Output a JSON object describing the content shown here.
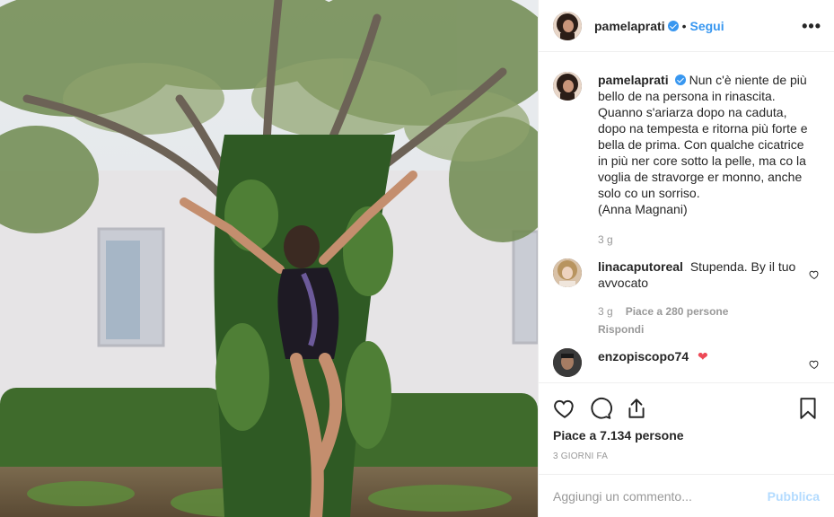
{
  "post": {
    "author": "pamelaprati",
    "follow_label": "Segui",
    "dot": "•",
    "more_label": "•••",
    "caption": {
      "username": "pamelaprati",
      "text_lines": [
        "Nun c'è niente de più",
        "bello de na persona in rinascita.",
        "Quanno s'ariarza dopo na caduta,",
        "dopo na tempesta e ritorna più forte e",
        "bella de prima. Con qualche cicatrice",
        "in più ner core sotto la pelle, ma co la",
        "voglia de stravorge er monno, anche",
        "solo co un sorriso.",
        "(Anna Magnani)"
      ],
      "time": "3 g"
    },
    "comments": [
      {
        "username": "linacaputoreal",
        "text": "Stupenda. By il tuo avvocato",
        "time": "3 g",
        "likes": "Piace a 280 persone",
        "reply": "Rispondi"
      },
      {
        "username": "enzopiscopo74",
        "text": "",
        "emoji": "❤"
      }
    ],
    "likes_label": "Piace a 7.134 persone",
    "date_label": "3 GIORNI FA",
    "comment_placeholder": "Aggiungi un commento...",
    "publish_label": "Pubblica",
    "icons": {
      "like": "heart-icon",
      "comment": "comment-bubble-icon",
      "share": "share-icon",
      "save": "bookmark-icon",
      "verified": "verified-badge-icon"
    },
    "colors": {
      "accent": "#3897f0",
      "publish_disabled": "#b3dbff",
      "heart_red": "#ed4956",
      "muted": "#999999"
    }
  }
}
